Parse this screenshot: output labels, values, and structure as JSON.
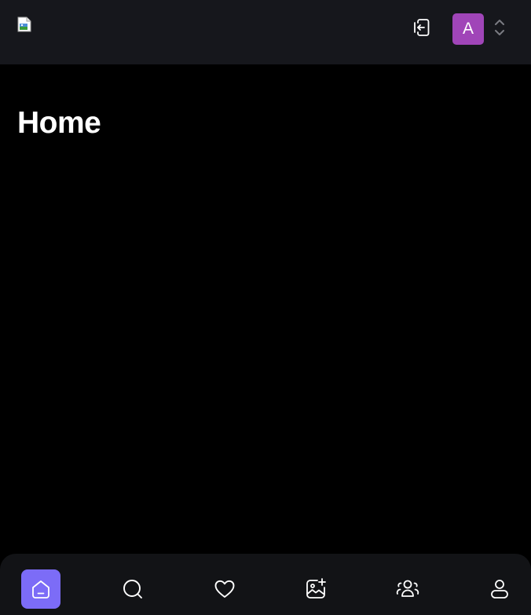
{
  "header": {
    "logo_alt": "",
    "avatar_letter": "A",
    "avatar_color": "#a045b8",
    "icons": {
      "switch": "login-switch-icon",
      "chevrons": "chevron-up-down-icon"
    }
  },
  "main": {
    "title": "Home"
  },
  "bottom_nav": {
    "accent_color": "#7c6cf7",
    "items": [
      {
        "name": "home",
        "icon": "home-icon",
        "active": true
      },
      {
        "name": "search",
        "icon": "search-icon",
        "active": false
      },
      {
        "name": "favorites",
        "icon": "heart-icon",
        "active": false
      },
      {
        "name": "add-image",
        "icon": "image-add-icon",
        "active": false
      },
      {
        "name": "community",
        "icon": "users-icon",
        "active": false
      },
      {
        "name": "profile",
        "icon": "user-icon",
        "active": false
      }
    ]
  }
}
